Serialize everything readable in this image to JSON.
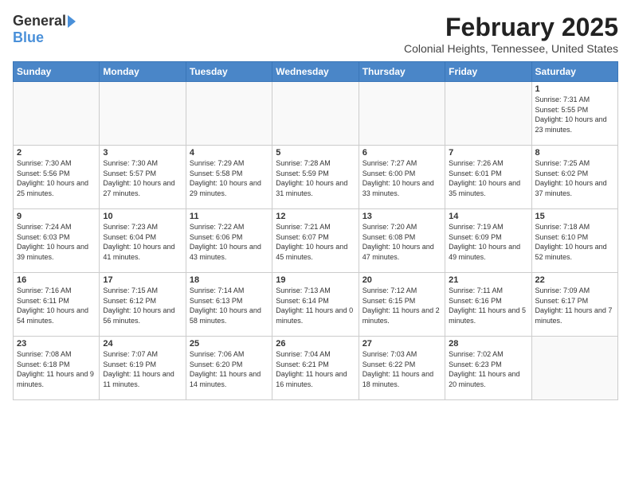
{
  "header": {
    "logo_general": "General",
    "logo_blue": "Blue",
    "month_title": "February 2025",
    "subtitle": "Colonial Heights, Tennessee, United States"
  },
  "weekdays": [
    "Sunday",
    "Monday",
    "Tuesday",
    "Wednesday",
    "Thursday",
    "Friday",
    "Saturday"
  ],
  "weeks": [
    [
      {
        "day": "",
        "info": ""
      },
      {
        "day": "",
        "info": ""
      },
      {
        "day": "",
        "info": ""
      },
      {
        "day": "",
        "info": ""
      },
      {
        "day": "",
        "info": ""
      },
      {
        "day": "",
        "info": ""
      },
      {
        "day": "1",
        "info": "Sunrise: 7:31 AM\nSunset: 5:55 PM\nDaylight: 10 hours and 23 minutes."
      }
    ],
    [
      {
        "day": "2",
        "info": "Sunrise: 7:30 AM\nSunset: 5:56 PM\nDaylight: 10 hours and 25 minutes."
      },
      {
        "day": "3",
        "info": "Sunrise: 7:30 AM\nSunset: 5:57 PM\nDaylight: 10 hours and 27 minutes."
      },
      {
        "day": "4",
        "info": "Sunrise: 7:29 AM\nSunset: 5:58 PM\nDaylight: 10 hours and 29 minutes."
      },
      {
        "day": "5",
        "info": "Sunrise: 7:28 AM\nSunset: 5:59 PM\nDaylight: 10 hours and 31 minutes."
      },
      {
        "day": "6",
        "info": "Sunrise: 7:27 AM\nSunset: 6:00 PM\nDaylight: 10 hours and 33 minutes."
      },
      {
        "day": "7",
        "info": "Sunrise: 7:26 AM\nSunset: 6:01 PM\nDaylight: 10 hours and 35 minutes."
      },
      {
        "day": "8",
        "info": "Sunrise: 7:25 AM\nSunset: 6:02 PM\nDaylight: 10 hours and 37 minutes."
      }
    ],
    [
      {
        "day": "9",
        "info": "Sunrise: 7:24 AM\nSunset: 6:03 PM\nDaylight: 10 hours and 39 minutes."
      },
      {
        "day": "10",
        "info": "Sunrise: 7:23 AM\nSunset: 6:04 PM\nDaylight: 10 hours and 41 minutes."
      },
      {
        "day": "11",
        "info": "Sunrise: 7:22 AM\nSunset: 6:06 PM\nDaylight: 10 hours and 43 minutes."
      },
      {
        "day": "12",
        "info": "Sunrise: 7:21 AM\nSunset: 6:07 PM\nDaylight: 10 hours and 45 minutes."
      },
      {
        "day": "13",
        "info": "Sunrise: 7:20 AM\nSunset: 6:08 PM\nDaylight: 10 hours and 47 minutes."
      },
      {
        "day": "14",
        "info": "Sunrise: 7:19 AM\nSunset: 6:09 PM\nDaylight: 10 hours and 49 minutes."
      },
      {
        "day": "15",
        "info": "Sunrise: 7:18 AM\nSunset: 6:10 PM\nDaylight: 10 hours and 52 minutes."
      }
    ],
    [
      {
        "day": "16",
        "info": "Sunrise: 7:16 AM\nSunset: 6:11 PM\nDaylight: 10 hours and 54 minutes."
      },
      {
        "day": "17",
        "info": "Sunrise: 7:15 AM\nSunset: 6:12 PM\nDaylight: 10 hours and 56 minutes."
      },
      {
        "day": "18",
        "info": "Sunrise: 7:14 AM\nSunset: 6:13 PM\nDaylight: 10 hours and 58 minutes."
      },
      {
        "day": "19",
        "info": "Sunrise: 7:13 AM\nSunset: 6:14 PM\nDaylight: 11 hours and 0 minutes."
      },
      {
        "day": "20",
        "info": "Sunrise: 7:12 AM\nSunset: 6:15 PM\nDaylight: 11 hours and 2 minutes."
      },
      {
        "day": "21",
        "info": "Sunrise: 7:11 AM\nSunset: 6:16 PM\nDaylight: 11 hours and 5 minutes."
      },
      {
        "day": "22",
        "info": "Sunrise: 7:09 AM\nSunset: 6:17 PM\nDaylight: 11 hours and 7 minutes."
      }
    ],
    [
      {
        "day": "23",
        "info": "Sunrise: 7:08 AM\nSunset: 6:18 PM\nDaylight: 11 hours and 9 minutes."
      },
      {
        "day": "24",
        "info": "Sunrise: 7:07 AM\nSunset: 6:19 PM\nDaylight: 11 hours and 11 minutes."
      },
      {
        "day": "25",
        "info": "Sunrise: 7:06 AM\nSunset: 6:20 PM\nDaylight: 11 hours and 14 minutes."
      },
      {
        "day": "26",
        "info": "Sunrise: 7:04 AM\nSunset: 6:21 PM\nDaylight: 11 hours and 16 minutes."
      },
      {
        "day": "27",
        "info": "Sunrise: 7:03 AM\nSunset: 6:22 PM\nDaylight: 11 hours and 18 minutes."
      },
      {
        "day": "28",
        "info": "Sunrise: 7:02 AM\nSunset: 6:23 PM\nDaylight: 11 hours and 20 minutes."
      },
      {
        "day": "",
        "info": ""
      }
    ]
  ]
}
